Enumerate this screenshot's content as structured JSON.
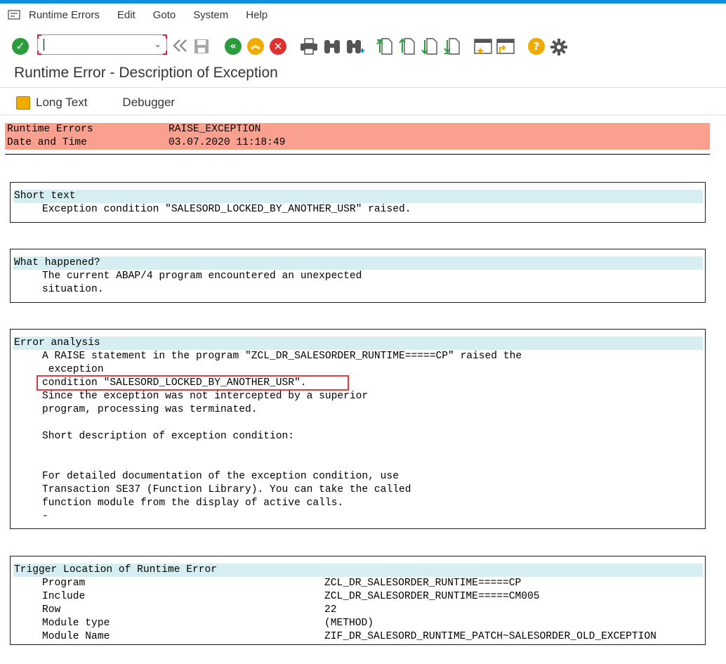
{
  "menubar": {
    "items": [
      "Runtime Errors",
      "Edit",
      "Goto",
      "System",
      "Help"
    ]
  },
  "toolbar": {
    "command_field_value": ""
  },
  "title": "Runtime Error - Description of Exception",
  "app_toolbar": {
    "long_text": "Long Text",
    "debugger": "Debugger"
  },
  "header": {
    "runtime_errors_label": "Runtime Errors",
    "runtime_errors_value": "RAISE_EXCEPTION",
    "date_time_label": "Date and Time",
    "date_time_value": "03.07.2020 11:18:49"
  },
  "short_text": {
    "title": "Short text",
    "lines": [
      "Exception condition \"SALESORD_LOCKED_BY_ANOTHER_USR\" raised."
    ]
  },
  "what_happened": {
    "title": "What happened?",
    "lines": [
      "The current ABAP/4 program encountered an unexpected",
      "situation."
    ]
  },
  "error_analysis": {
    "title": "Error analysis",
    "lines": [
      "A RAISE statement in the program \"ZCL_DR_SALESORDER_RUNTIME=====CP\" raised the",
      " exception",
      "condition \"SALESORD_LOCKED_BY_ANOTHER_USR\".",
      "Since the exception was not intercepted by a superior",
      "program, processing was terminated.",
      "",
      "Short description of exception condition:",
      "",
      "",
      "For detailed documentation of the exception condition, use",
      "Transaction SE37 (Function Library). You can take the called",
      "function module from the display of active calls.",
      "-"
    ]
  },
  "trigger_location": {
    "title": "Trigger Location of Runtime Error",
    "rows": [
      {
        "key": "Program",
        "value": "ZCL_DR_SALESORDER_RUNTIME=====CP"
      },
      {
        "key": "Include",
        "value": "ZCL_DR_SALESORDER_RUNTIME=====CM005"
      },
      {
        "key": "Row",
        "value": "22"
      },
      {
        "key": "Module type",
        "value": "(METHOD)"
      },
      {
        "key": "Module Name",
        "value": "ZIF_DR_SALESORD_RUNTIME_PATCH~SALESORDER_OLD_EXCEPTION"
      }
    ]
  },
  "colors": {
    "header_bg": "#f9a08f",
    "section_title_bg": "#d6eef2",
    "highlight_border": "#e2373b",
    "top_accent": "#0a91d8"
  },
  "icons": {
    "toolbar": [
      "enter-icon",
      "back-icon",
      "save-icon",
      "back-green-icon",
      "exit-icon",
      "cancel-icon",
      "print-icon",
      "find-icon",
      "find-next-icon",
      "first-page-icon",
      "previous-page-icon",
      "next-page-icon",
      "last-page-icon",
      "create-session-icon",
      "shortcut-icon",
      "help-icon",
      "settings-icon"
    ]
  }
}
